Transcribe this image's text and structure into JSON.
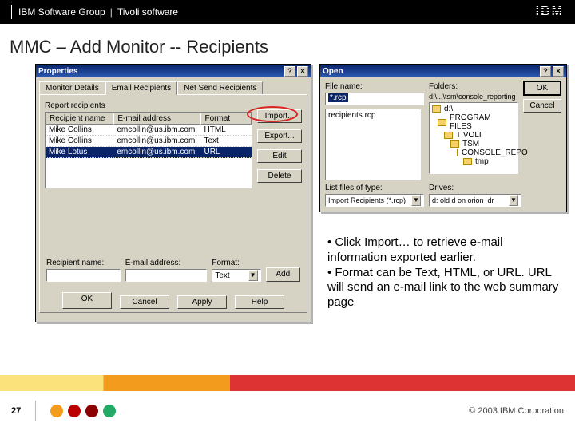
{
  "topbar": {
    "group": "IBM Software Group",
    "product": "Tivoli software",
    "logo": "IBM"
  },
  "slide_title": "MMC – Add Monitor -- Recipients",
  "properties": {
    "title": "Properties",
    "tabs": [
      "Monitor Details",
      "Email Recipients",
      "Net Send Recipients"
    ],
    "report_label": "Report recipients",
    "columns": [
      "Recipient name",
      "E-mail address",
      "Format"
    ],
    "rows": [
      {
        "name": "Mike Collins",
        "email": "emcollin@us.ibm.com",
        "fmt": "HTML"
      },
      {
        "name": "Mike Collins",
        "email": "emcollin@us.ibm.com",
        "fmt": "Text"
      },
      {
        "name": "Mike Lotus",
        "email": "emcollin@us.ibm.com",
        "fmt": "URL"
      }
    ],
    "side_buttons": [
      "Import...",
      "Export...",
      "Edit",
      "Delete"
    ],
    "add_section": {
      "name_label": "Recipient name:",
      "email_label": "E-mail address:",
      "format_label": "Format:",
      "format_value": "Text",
      "add_button": "Add"
    },
    "dialog_buttons": [
      "OK",
      "Cancel",
      "Apply",
      "Help"
    ]
  },
  "open": {
    "title": "Open",
    "filename_label": "File name:",
    "filename_value": "*.rcp",
    "folders_label": "Folders:",
    "folders_path": "d:\\...\\tsm\\console_reporting",
    "ok": "OK",
    "cancel": "Cancel",
    "file_items": [
      "recipients.rcp"
    ],
    "folder_items": [
      "d:\\",
      "PROGRAM FILES",
      "TIVOLI",
      "TSM",
      "CONSOLE_REPO",
      "tmp"
    ],
    "type_label": "List files of type:",
    "type_value": "Import Recipients (*.rcp)",
    "drives_label": "Drives:",
    "drives_value": "d: old d on orion_dr"
  },
  "notes": [
    "• Click Import… to retrieve e-mail information exported earlier.",
    "• Format can be Text, HTML, or URL.  URL will send an e-mail link to the web summary page"
  ],
  "footer": {
    "page": "27",
    "copyright": "© 2003 IBM Corporation"
  }
}
